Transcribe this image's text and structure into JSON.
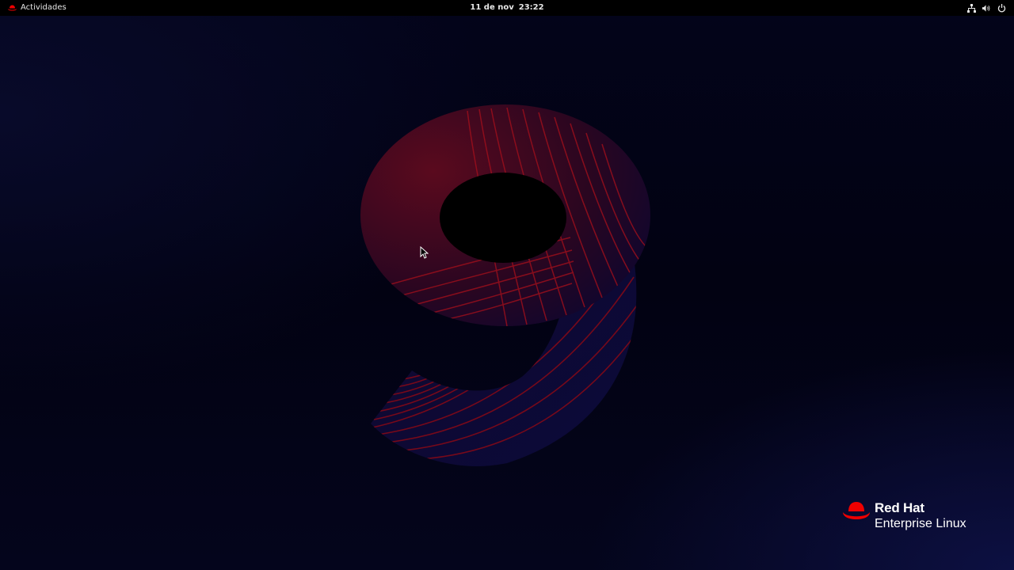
{
  "topbar": {
    "activities_label": "Actividades",
    "date": "11 de nov",
    "time": "23:22",
    "icons": [
      "network-icon",
      "volume-icon",
      "power-icon"
    ]
  },
  "desktop": {
    "wallpaper_numeral": "9",
    "brand_line1": "Red Hat",
    "brand_line2": "Enterprise Linux"
  },
  "colors": {
    "accent_red": "#ee0000",
    "panel_bg": "#000000",
    "wallpaper_navy": "#04051c"
  }
}
